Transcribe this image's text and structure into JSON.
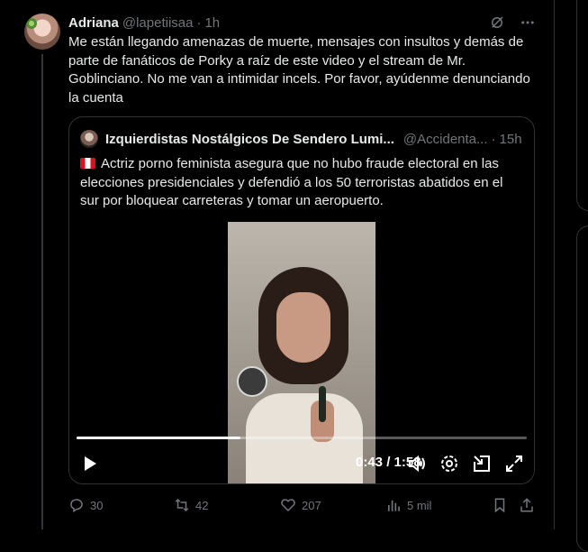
{
  "tweet": {
    "author_name": "Adriana",
    "author_handle": "@lapetiisaa",
    "separator": "·",
    "time": "1h",
    "text": "Me están llegando amenazas de muerte, mensajes con insultos y demás de parte de fanáticos de Porky a raíz de este video y el stream de Mr. Goblinciano. No me van a intimidar incels. Por favor, ayúdenme denunciando la cuenta",
    "icons": [
      "grok-icon",
      "more-icon"
    ]
  },
  "quote": {
    "author_name": "Izquierdistas Nostálgicos De Sendero Lumi...",
    "author_handle": "@Accidenta...",
    "separator": "·",
    "time": "15h",
    "flag_icon": "peru-flag-icon",
    "text": "Actriz porno feminista asegura que no hubo fraude electoral en las elecciones presidenciales y defendió a los 50 terroristas abatidos en el sur por bloquear carreteras y tomar un aeropuerto."
  },
  "video": {
    "time_display": "0:43 / 1:58",
    "progress": 0.3644,
    "controls": [
      "play-icon",
      "volume-icon",
      "settings-icon",
      "pip-icon",
      "fullscreen-icon"
    ]
  },
  "actions": {
    "replies": "30",
    "reposts": "42",
    "likes": "207",
    "views": "5 mil"
  },
  "colors": {
    "background": "#000000",
    "text": "#e7e9ea",
    "muted": "#71767b",
    "border": "#2f3336"
  }
}
